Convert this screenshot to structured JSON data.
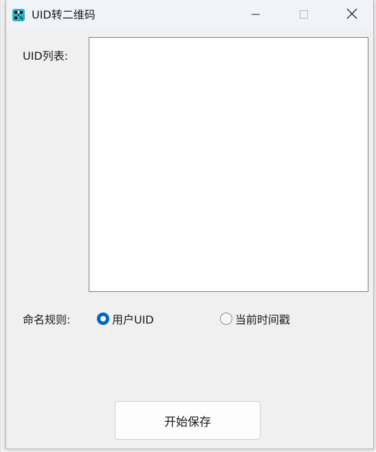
{
  "window": {
    "title": "UID转二维码",
    "icon": "qr-app-icon"
  },
  "titlebar": {
    "minimize_icon": "minimize-icon",
    "maximize_icon": "maximize-icon",
    "close_icon": "close-icon"
  },
  "form": {
    "uid_list_label": "UID列表:",
    "uid_list_value": "",
    "naming_rule_label": "命名规则:",
    "naming_options": [
      {
        "label": "用户UID",
        "selected": true
      },
      {
        "label": "当前时间戳",
        "selected": false
      }
    ],
    "start_button_label": "开始保存"
  },
  "colors": {
    "accent": "#0067c0",
    "window_bg": "#f0f0f0",
    "titlebar_bg": "#f0f4f9"
  }
}
